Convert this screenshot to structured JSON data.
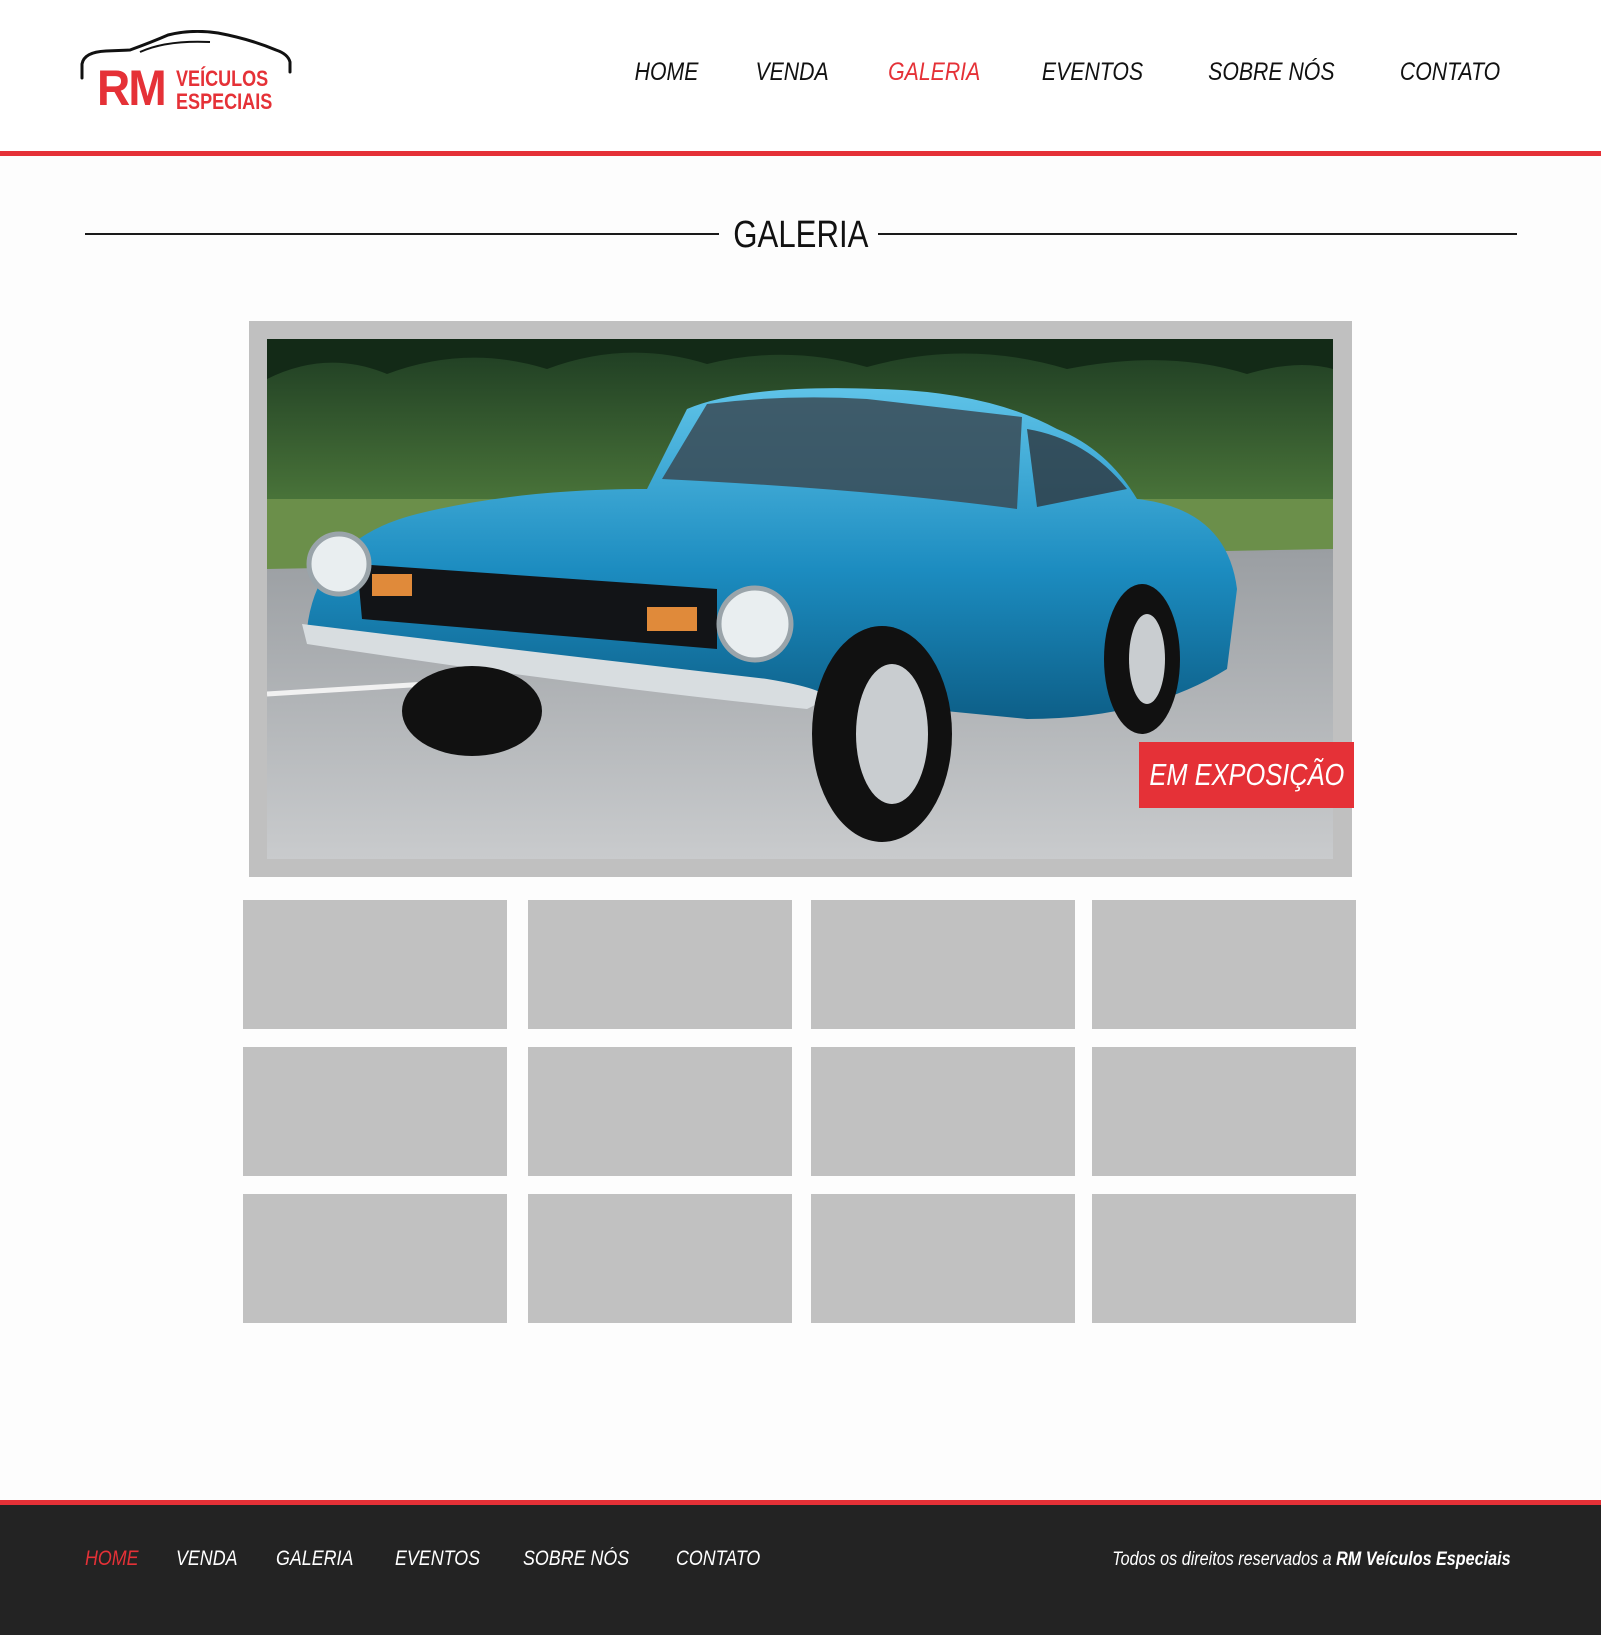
{
  "brand": {
    "initials": "RM",
    "word1": "VEÍCULOS",
    "word2": "ESPECIAIS",
    "color": "#e53137"
  },
  "header": {
    "nav": [
      {
        "label": "HOME",
        "active": false
      },
      {
        "label": "VENDA",
        "active": false
      },
      {
        "label": "GALERIA",
        "active": true
      },
      {
        "label": "EVENTOS",
        "active": false
      },
      {
        "label": "SOBRE NÓS",
        "active": false
      },
      {
        "label": "CONTATO",
        "active": false
      }
    ]
  },
  "main": {
    "title": "GALERIA",
    "featured": {
      "badge": "EM EXPOSIÇÃO"
    },
    "thumbnail_count": 12
  },
  "footer": {
    "nav": [
      {
        "label": "HOME",
        "active": true
      },
      {
        "label": "VENDA",
        "active": false
      },
      {
        "label": "GALERIA",
        "active": false
      },
      {
        "label": "EVENTOS",
        "active": false
      },
      {
        "label": "SOBRE NÓS",
        "active": false
      },
      {
        "label": "CONTATO",
        "active": false
      }
    ],
    "copyright_prefix": "Todos os direitos reservados a",
    "copyright_brand": "RM Veículos Especiais"
  },
  "colors": {
    "accent": "#e53137",
    "footer_bg": "#232323",
    "placeholder": "#c1c1c1"
  }
}
